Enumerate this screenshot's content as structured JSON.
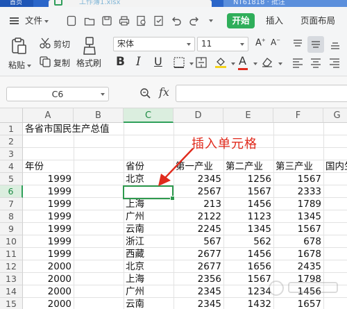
{
  "tabs": {
    "home_label": "首页",
    "doc_title": "工作簿1.xlsx",
    "other_tab": "NT61818 · 批注"
  },
  "menu": {
    "file_label": "文件",
    "start_label": "开始",
    "insert_label": "插入",
    "layout_label": "页面布局"
  },
  "ribbon": {
    "paste_label": "粘贴",
    "cut_label": "剪切",
    "copy_label": "复制",
    "format_painter_label": "格式刷",
    "font_name": "宋体",
    "font_size": "11",
    "bold_glyph": "B",
    "italic_glyph": "I",
    "underline_glyph": "U",
    "font_color_glyph": "A",
    "accent_red": "#e02a1c",
    "accent_yellow": "#f5d31b"
  },
  "formula_bar": {
    "cell_ref": "C6",
    "fx_label": "fx",
    "value": ""
  },
  "sheet": {
    "columns": [
      "A",
      "B",
      "C",
      "D",
      "E",
      "F",
      "G"
    ],
    "selected_column": "C",
    "selected_row": "6",
    "rows": [
      {
        "n": "1",
        "a": "各省市国民生产总值",
        "c": "",
        "d": "",
        "e": "",
        "f": "",
        "g": ""
      },
      {
        "n": "2",
        "a": "",
        "c": "",
        "d": "",
        "e": "",
        "f": "",
        "g": ""
      },
      {
        "n": "3",
        "a": "",
        "c": "",
        "d": "",
        "e": "",
        "f": "",
        "g": ""
      },
      {
        "n": "4",
        "a": "年份",
        "c": "省份",
        "d": "第一产业",
        "e": "第二产业",
        "f": "第三产业",
        "g": "国内生"
      },
      {
        "n": "5",
        "a": "1999",
        "c": "北京",
        "d": "2345",
        "e": "1256",
        "f": "1567",
        "g": ""
      },
      {
        "n": "6",
        "a": "1999",
        "c": "",
        "d": "2567",
        "e": "1567",
        "f": "2333",
        "g": ""
      },
      {
        "n": "7",
        "a": "1999",
        "c": "上海",
        "d": "213",
        "e": "1456",
        "f": "1789",
        "g": ""
      },
      {
        "n": "8",
        "a": "1999",
        "c": "广州",
        "d": "2122",
        "e": "1123",
        "f": "1345",
        "g": ""
      },
      {
        "n": "9",
        "a": "1999",
        "c": "云南",
        "d": "2245",
        "e": "1345",
        "f": "1567",
        "g": ""
      },
      {
        "n": "10",
        "a": "1999",
        "c": "浙江",
        "d": "567",
        "e": "562",
        "f": "678",
        "g": ""
      },
      {
        "n": "11",
        "a": "1999",
        "c": "西藏",
        "d": "2677",
        "e": "1456",
        "f": "1678",
        "g": ""
      },
      {
        "n": "12",
        "a": "2000",
        "c": "北京",
        "d": "2677",
        "e": "1656",
        "f": "2435",
        "g": ""
      },
      {
        "n": "13",
        "a": "2000",
        "c": "上海",
        "d": "2356",
        "e": "1567",
        "f": "1798",
        "g": ""
      },
      {
        "n": "14",
        "a": "2000",
        "c": "广州",
        "d": "2345",
        "e": "1234",
        "f": "1456",
        "g": ""
      },
      {
        "n": "15",
        "a": "2000",
        "c": "云南",
        "d": "2345",
        "e": "1432",
        "f": "1657",
        "g": ""
      }
    ]
  },
  "annotation": {
    "text": "插入单元格",
    "color": "#e02a1c"
  }
}
